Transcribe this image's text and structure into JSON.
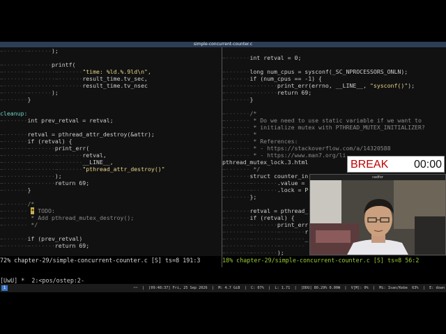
{
  "window": {
    "title": "simple-concurrent-counter.c"
  },
  "left_pane": {
    "lines": [
      {
        "ws": "~·······~······",
        "text": ");"
      },
      {
        "ws": "",
        "text": ""
      },
      {
        "ws": "~·······~······",
        "text": "printf("
      },
      {
        "ws": "~·······~·······~·······",
        "text": "",
        "str": "\"time: %ld.%.9ld\\n\","
      },
      {
        "ws": "~·······~·······~·······",
        "text": "result_time.tv_sec,"
      },
      {
        "ws": "~·······~·······~·······",
        "text": "result_time.tv_nsec"
      },
      {
        "ws": "~·······~······",
        "text": ");"
      },
      {
        "ws": "~·······",
        "text": "}"
      },
      {
        "ws": "",
        "text": ""
      },
      {
        "ws": "",
        "text": "",
        "label": "cleanup:"
      },
      {
        "ws": "~·······",
        "text": "int prev_retval = retval;"
      },
      {
        "ws": "",
        "text": ""
      },
      {
        "ws": "~·······",
        "text": "retval = pthread_attr_destroy(&attr);"
      },
      {
        "ws": "~·······",
        "text": "if (retval) {"
      },
      {
        "ws": "~·······~·······",
        "text": "print_err("
      },
      {
        "ws": "~·······~·······~·······",
        "text": "retval,"
      },
      {
        "ws": "~·······~·······~·······",
        "text": "__LINE__,"
      },
      {
        "ws": "~·······~·······~·······",
        "text": "",
        "str": "\"pthread_attr_destroy()\""
      },
      {
        "ws": "~·······~·······",
        "text": ");"
      },
      {
        "ws": "~·······~·······",
        "text": "return 69;"
      },
      {
        "ws": "~·······",
        "text": "}"
      },
      {
        "ws": "",
        "text": ""
      },
      {
        "ws": "~·······",
        "text": "",
        "com": "/*"
      },
      {
        "ws": "~······· ",
        "text": "",
        "todo": "*",
        "com": " TODO:"
      },
      {
        "ws": "~······· ",
        "text": "",
        "com": "* Add pthread_mutex_destroy();"
      },
      {
        "ws": "~······· ",
        "text": "",
        "com": "*/"
      },
      {
        "ws": "",
        "text": ""
      },
      {
        "ws": "~·······",
        "text": "if (prev_retval)"
      },
      {
        "ws": "~·······~·······",
        "text": "return 69;"
      }
    ],
    "status": "72% chapter-29/simple-concurrent-counter.c [S] ts=8 191:3"
  },
  "right_pane": {
    "lines": [
      {
        "ws": "",
        "text": ""
      },
      {
        "ws": "~·······",
        "text": "int retval = 0;"
      },
      {
        "ws": "",
        "text": ""
      },
      {
        "ws": "~·······",
        "text": "long num_cpus = sysconf(_SC_NPROCESSORS_ONLN);"
      },
      {
        "ws": "~·······",
        "text": "if (num_cpus == -1) {"
      },
      {
        "ws": "~·······~·······",
        "text": "print_err(errno, __LINE__, ",
        "str": "\"sysconf()\"",
        "tail": ");"
      },
      {
        "ws": "~·······~·······",
        "text": "return 69;"
      },
      {
        "ws": "~·······",
        "text": "}"
      },
      {
        "ws": "",
        "text": ""
      },
      {
        "ws": "~·······",
        "text": "",
        "com": "/*"
      },
      {
        "ws": "~·······",
        "text": "",
        "com": " * Do we need to use static variable if we want to"
      },
      {
        "ws": "~·······",
        "text": "",
        "com": " * initialize mutex with PTHREAD_MUTEX_INITIALIZER?"
      },
      {
        "ws": "~·······",
        "text": "",
        "com": " *"
      },
      {
        "ws": "~·······",
        "text": "",
        "com": " * References:"
      },
      {
        "ws": "~·······",
        "text": "",
        "com": " * - https://stackoverflow.com/a/14320588"
      },
      {
        "ws": "~·······",
        "text": "",
        "com": " * - https://www.man7.org/li"
      },
      {
        "ws": "",
        "text": "pthread_mutex_lock.3.html"
      },
      {
        "ws": "~·······",
        "text": "",
        "com": " */"
      },
      {
        "ws": "~·······",
        "text": "struct counter_in"
      },
      {
        "ws": "~·······~·······",
        "text": ".value ="
      },
      {
        "ws": "~·······~·······",
        "text": ".lock = P"
      },
      {
        "ws": "~·······",
        "text": "};"
      },
      {
        "ws": "",
        "text": ""
      },
      {
        "ws": "~·······",
        "text": "retval = pthread_"
      },
      {
        "ws": "~·······",
        "text": "if (retval) {"
      },
      {
        "ws": "~·······~·······",
        "text": "print_err"
      },
      {
        "ws": "~·······~·······~·······",
        "text": "r"
      },
      {
        "ws": "~·······~·······~·······",
        "text": "_"
      },
      {
        "ws": "~·······~·······~·······",
        "text": ""
      },
      {
        "ws": "~·······~·······",
        "text": ");"
      }
    ],
    "status": "18% chapter-29/simple-concurrent-counter.c [S] ts=8 56:2"
  },
  "tmux_bar": "[UwU] *  2:<pos/ostep:2-",
  "bottom_bar": {
    "workspace": "1",
    "info": "~~  |  [09:48:37] Fri, 25 Sep 2026  |  M: 4.7 GiB  |  C: 07%  |  L: 1.71  |  [DDU] 80.29% 0.00W  |  V[M]: 0%  |  Mi: Isan/Kebe  63%  |  E: down"
  },
  "break_timer": {
    "label": "BREAK",
    "time": "00:00"
  },
  "webcam": {
    "title": "cadfor"
  }
}
